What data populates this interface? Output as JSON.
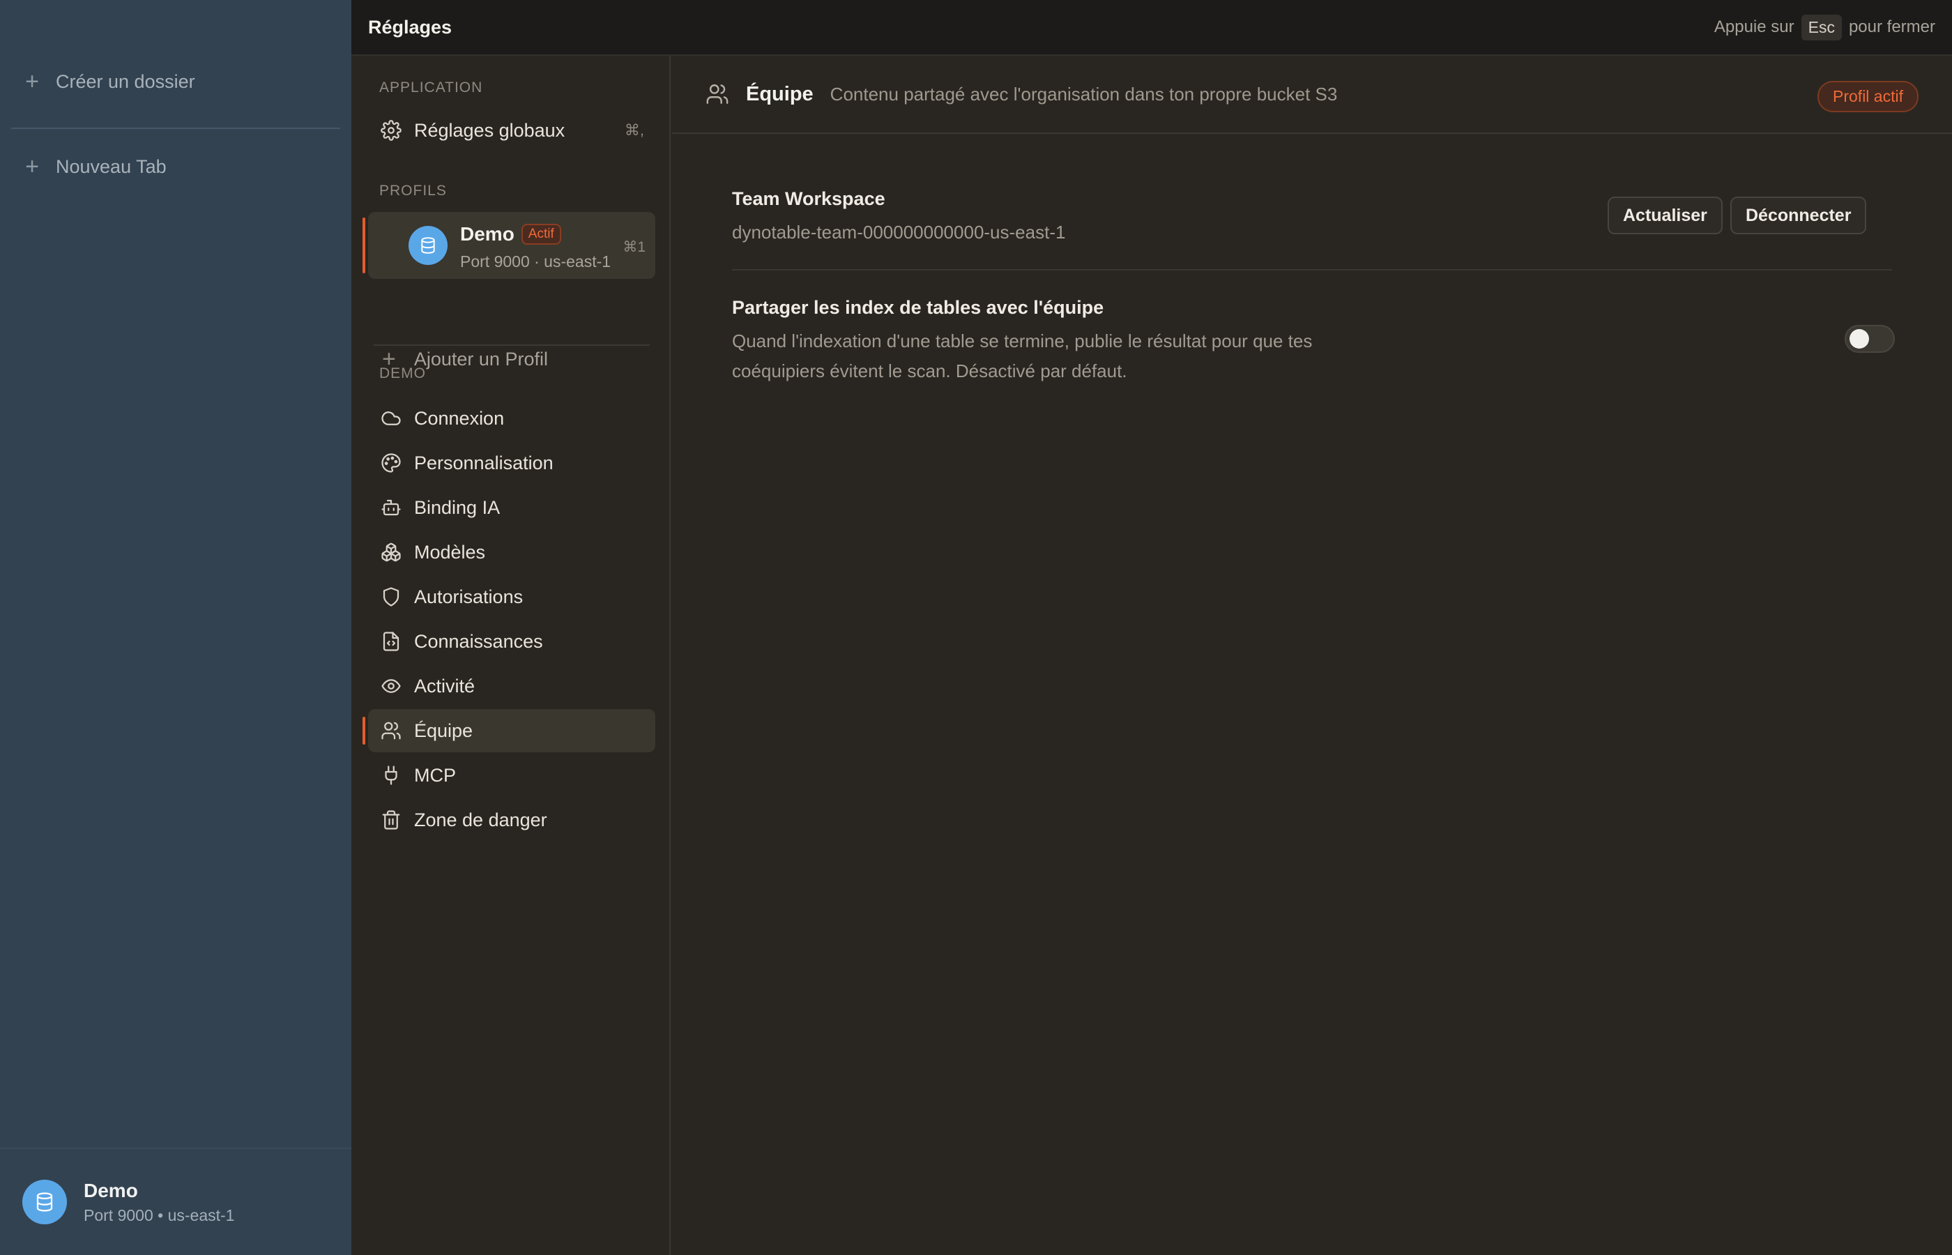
{
  "app_sidebar": {
    "create_folder": "Créer un dossier",
    "new_tab": "Nouveau Tab",
    "footer": {
      "name": "Demo",
      "subtitle": "Port 9000 • us-east-1"
    }
  },
  "topbar": {
    "title": "Réglages",
    "hint_before": "Appuie sur",
    "hint_key": "Esc",
    "hint_after": "pour fermer"
  },
  "nav": {
    "application_section": "APPLICATION",
    "global_settings": {
      "label": "Réglages globaux",
      "shortcut": "⌘,"
    },
    "profiles_section": "PROFILS",
    "profile": {
      "name": "Demo",
      "badge": "Actif",
      "subtitle": "Port 9000 · us-east-1",
      "shortcut": "⌘1"
    },
    "add_profile": "Ajouter un Profil",
    "demo_section": "DEMO",
    "items": [
      {
        "label": "Connexion",
        "icon": "cloud-icon"
      },
      {
        "label": "Personnalisation",
        "icon": "palette-icon"
      },
      {
        "label": "Binding IA",
        "icon": "bot-icon"
      },
      {
        "label": "Modèles",
        "icon": "boxes-icon"
      },
      {
        "label": "Autorisations",
        "icon": "shield-icon"
      },
      {
        "label": "Connaissances",
        "icon": "file-code-icon"
      },
      {
        "label": "Activité",
        "icon": "eye-icon"
      },
      {
        "label": "Équipe",
        "icon": "users-icon",
        "active": true
      },
      {
        "label": "MCP",
        "icon": "plug-icon"
      },
      {
        "label": "Zone de danger",
        "icon": "trash-icon"
      }
    ]
  },
  "content": {
    "title": "Équipe",
    "description": "Contenu partagé avec l'organisation dans ton propre bucket S3",
    "badge": "Profil actif",
    "workspace": {
      "title": "Team Workspace",
      "bucket": "dynotable-team-000000000000-us-east-1",
      "refresh_label": "Actualiser",
      "disconnect_label": "Déconnecter"
    },
    "share_index": {
      "title": "Partager les index de tables avec l'équipe",
      "description_line1": "Quand l'indexation d'une table se termine, publie le résultat pour que tes",
      "description_line2": "coéquipiers évitent le scan. Désactivé par défaut.",
      "enabled": false
    }
  },
  "colors": {
    "accent": "#e35d2c",
    "avatar": "#5aa7e8",
    "app_sidebar_bg": "#324250",
    "panel_bg": "#292621"
  }
}
